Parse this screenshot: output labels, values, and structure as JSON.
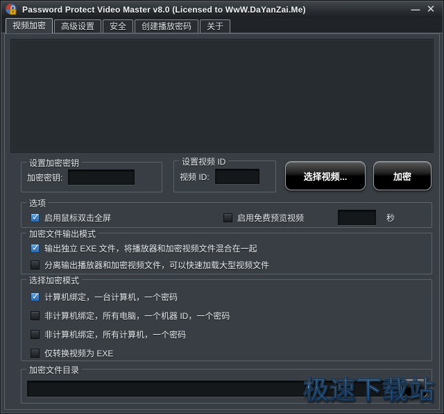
{
  "window": {
    "title": "Password Protect Video Master v8.0 (Licensed to WwW.DaYanZai.Me)",
    "minimize_glyph": "—",
    "close_glyph": "✕"
  },
  "tabs": [
    {
      "label": "视频加密",
      "active": true
    },
    {
      "label": "高级设置",
      "active": false
    },
    {
      "label": "安全",
      "active": false
    },
    {
      "label": "创建播放密码",
      "active": false
    },
    {
      "label": "关于",
      "active": false
    }
  ],
  "encryption_key_group": {
    "title": "设置加密密钥",
    "label": "加密密钥:",
    "value": ""
  },
  "video_id_group": {
    "title": "设置视频 ID",
    "label": "视频 ID:",
    "value": ""
  },
  "buttons": {
    "select_video": "选择视频...",
    "encrypt": "加密"
  },
  "options_group": {
    "title": "选项",
    "fullscreen_checkbox": {
      "label": "启用鼠标双击全屏",
      "checked": true
    },
    "preview_checkbox": {
      "label": "启用免费预览视频",
      "checked": false
    },
    "preview_seconds_value": "",
    "seconds_label": "秒"
  },
  "output_mode_group": {
    "title": "加密文件输出模式",
    "options": [
      {
        "label": "输出独立 EXE 文件，将播放器和加密视频文件混合在一起",
        "checked": true
      },
      {
        "label": "分离输出播放器和加密视频文件，可以快速加载大型视频文件",
        "checked": false
      }
    ]
  },
  "encrypt_mode_group": {
    "title": "选择加密模式",
    "options": [
      {
        "label": "计算机绑定，一台计算机，一个密码",
        "checked": true
      },
      {
        "label": "非计算机绑定，所有电脑，一个机器 ID，一个密码",
        "checked": false
      },
      {
        "label": "非计算机绑定，所有计算机，一个密码",
        "checked": false
      },
      {
        "label": "仅转换视频为 EXE",
        "checked": false
      }
    ]
  },
  "output_dir_group": {
    "title": "加密文件目录",
    "value": ""
  },
  "watermark": "极速下载站",
  "colors": {
    "accent_checkbox": "#3d7fc4",
    "window_bg": "#383e43",
    "preview_bg": "#272c31",
    "watermark_blue": "#4e8ecd"
  }
}
